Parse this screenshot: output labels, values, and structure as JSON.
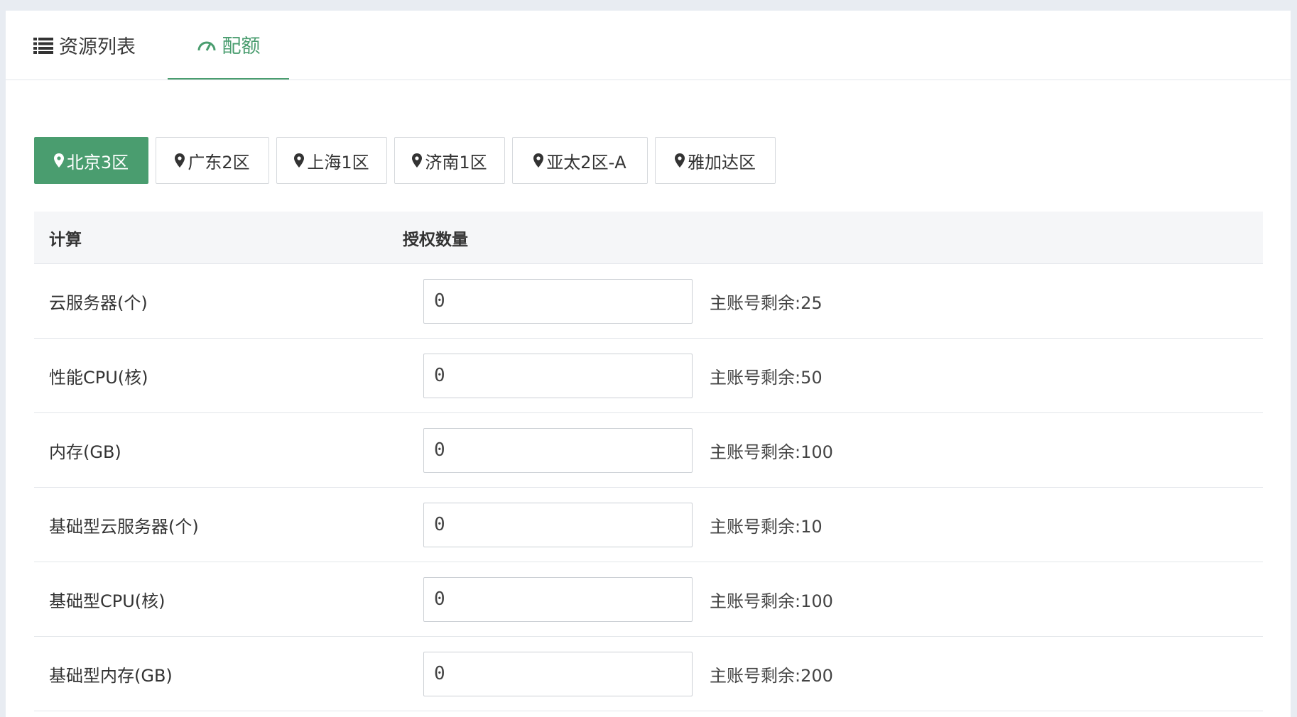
{
  "tabs": {
    "resources_label": "资源列表",
    "quota_label": "配额",
    "active": "quota"
  },
  "regions": [
    {
      "label": "北京3区",
      "active": true
    },
    {
      "label": "广东2区",
      "active": false
    },
    {
      "label": "上海1区",
      "active": false
    },
    {
      "label": "济南1区",
      "active": false
    },
    {
      "label": "亚太2区-A",
      "active": false
    },
    {
      "label": "雅加达区",
      "active": false
    }
  ],
  "table": {
    "header_name": "计算",
    "header_quota": "授权数量",
    "rows": [
      {
        "name": "云服务器(个)",
        "value": "0",
        "remaining": "主账号剩余:25"
      },
      {
        "name": "性能CPU(核)",
        "value": "0",
        "remaining": "主账号剩余:50"
      },
      {
        "name": "内存(GB)",
        "value": "0",
        "remaining": "主账号剩余:100"
      },
      {
        "name": "基础型云服务器(个)",
        "value": "0",
        "remaining": "主账号剩余:10"
      },
      {
        "name": "基础型CPU(核)",
        "value": "0",
        "remaining": "主账号剩余:100"
      },
      {
        "name": "基础型内存(GB)",
        "value": "0",
        "remaining": "主账号剩余:200"
      }
    ]
  },
  "colors": {
    "accent": "#4a9d6f",
    "page_bg": "#e8ecf2",
    "header_bg": "#f5f6f8"
  },
  "icons": {
    "resources_tab": "list-icon",
    "quota_tab": "gauge-icon",
    "region": "map-pin-icon"
  }
}
